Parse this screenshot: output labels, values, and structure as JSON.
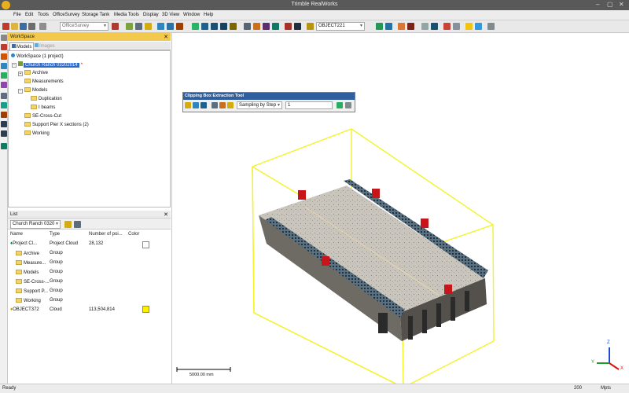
{
  "window": {
    "title": "Trimble RealWorks",
    "controls": {
      "min": "–",
      "max": "▢",
      "close": "✕"
    }
  },
  "menu": [
    "File",
    "Edit",
    "Tools",
    "OfficeSurvey",
    "Storage Tank",
    "Media Tools",
    "Display",
    "3D View",
    "Window",
    "Help"
  ],
  "toolbar": {
    "module_combo": "OfficeSurvey",
    "object_combo": "OBJECT221"
  },
  "workspace": {
    "title": "WorkSpace",
    "tabs": [
      "Models",
      "Images"
    ],
    "root": "WorkSpace  (1 project)",
    "project": "Church Ranch 03202014",
    "items": [
      "Archive",
      "Measurements",
      "Models",
      "Duplication",
      "I beams",
      "SE-Cross-Cut",
      "Support Pier X sections (2)",
      "Working"
    ]
  },
  "list": {
    "title": "List",
    "combo": "Church Ranch 0320",
    "columns": [
      "Name",
      "Type",
      "Number of poi...",
      "Color"
    ],
    "rows": [
      {
        "name": "Project Cl...",
        "type": "Project Cloud",
        "points": "28,132"
      },
      {
        "name": "Archive",
        "type": "Group",
        "points": ""
      },
      {
        "name": "Measure...",
        "type": "Group",
        "points": ""
      },
      {
        "name": "Models",
        "type": "Group",
        "points": ""
      },
      {
        "name": "SE-Cross-...",
        "type": "Group",
        "points": ""
      },
      {
        "name": "Support P...",
        "type": "Group",
        "points": ""
      },
      {
        "name": "Working",
        "type": "Group",
        "points": ""
      },
      {
        "name": "OBJECT372",
        "type": "Cloud",
        "points": "113,504,814"
      }
    ],
    "colors": {
      "project_cloud": "#ffffff",
      "object372": "#ffee00"
    }
  },
  "clipping_tool": {
    "title": "Clipping Box Extraction Tool",
    "mode": "Sampling by Step",
    "value": "1"
  },
  "viewport": {
    "scale_label": "5000.00 mm",
    "axes": {
      "x": "X",
      "y": "Y",
      "z": "Z"
    },
    "box_color": "#f3f32a",
    "marker_color": "#c8151b"
  },
  "status": {
    "left": "Ready",
    "value": "200",
    "unit": "Mpts"
  }
}
